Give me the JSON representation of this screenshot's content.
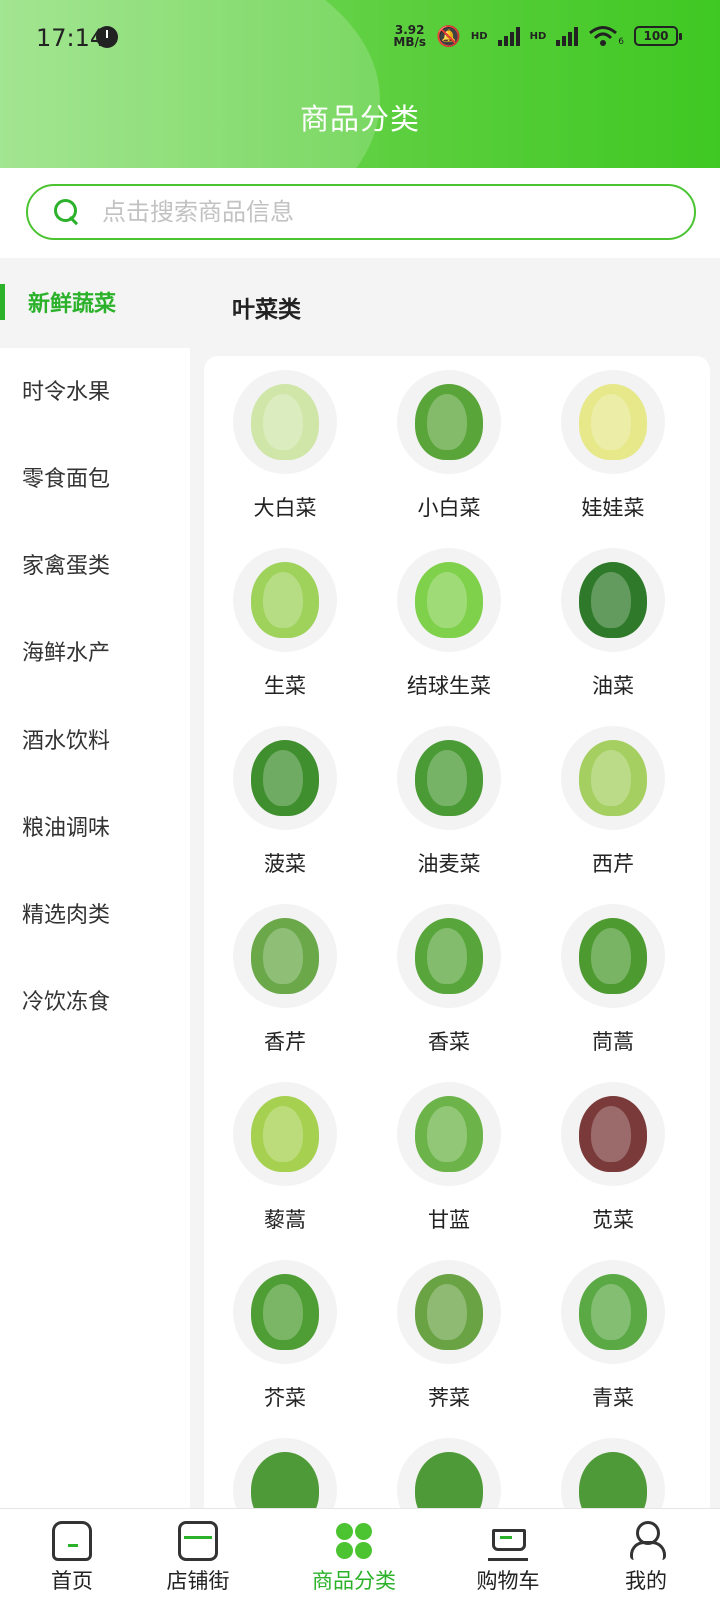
{
  "status_bar": {
    "time": "17:14",
    "net_speed_value": "3.92",
    "net_speed_unit": "MB/s",
    "hd1": "HD",
    "hd2": "HD",
    "wifi_sub": "6",
    "battery": "100"
  },
  "header": {
    "title": "商品分类"
  },
  "search": {
    "placeholder": "点击搜索商品信息",
    "value": ""
  },
  "sidebar": {
    "active": "新鲜蔬菜",
    "items": [
      "时令水果",
      "零食面包",
      "家禽蛋类",
      "海鲜水产",
      "酒水饮料",
      "粮油调味",
      "精选肉类",
      "冷饮冻食"
    ]
  },
  "content": {
    "category_title": "叶菜类",
    "products": [
      {
        "name": "大白菜",
        "icon": "napa-cabbage",
        "color": "#cfe6a8"
      },
      {
        "name": "小白菜",
        "icon": "bok-choy",
        "color": "#5aa53a"
      },
      {
        "name": "娃娃菜",
        "icon": "baby-cabbage",
        "color": "#e6e88a"
      },
      {
        "name": "生菜",
        "icon": "lettuce",
        "color": "#9ed25a"
      },
      {
        "name": "结球生菜",
        "icon": "iceberg-lettuce",
        "color": "#7fd04a"
      },
      {
        "name": "油菜",
        "icon": "rape-greens",
        "color": "#2f7a2a"
      },
      {
        "name": "菠菜",
        "icon": "spinach",
        "color": "#3f8f2e"
      },
      {
        "name": "油麦菜",
        "icon": "indian-lettuce",
        "color": "#4a9a35"
      },
      {
        "name": "西芹",
        "icon": "celery",
        "color": "#a6cf62"
      },
      {
        "name": "香芹",
        "icon": "celery-leaf",
        "color": "#6aa84a"
      },
      {
        "name": "香菜",
        "icon": "coriander",
        "color": "#58a63b"
      },
      {
        "name": "茼蒿",
        "icon": "crown-daisy",
        "color": "#4d9a31"
      },
      {
        "name": "藜蒿",
        "icon": "artemisia",
        "color": "#a6d04f"
      },
      {
        "name": "甘蓝",
        "icon": "cabbage",
        "color": "#6cb449"
      },
      {
        "name": "苋菜",
        "icon": "amaranth",
        "color": "#7a3a3a"
      },
      {
        "name": "芥菜",
        "icon": "mustard-greens",
        "color": "#4f9e35"
      },
      {
        "name": "荠菜",
        "icon": "shepherds-purse",
        "color": "#6aa344"
      },
      {
        "name": "青菜",
        "icon": "green-vegetable",
        "color": "#5aa945"
      }
    ]
  },
  "tabbar": {
    "tabs": [
      {
        "label": "首页",
        "icon": "home-icon"
      },
      {
        "label": "店铺街",
        "icon": "shop-icon"
      },
      {
        "label": "商品分类",
        "icon": "category-icon"
      },
      {
        "label": "购物车",
        "icon": "cart-icon"
      },
      {
        "label": "我的",
        "icon": "profile-icon"
      }
    ],
    "active_index": 2,
    "active_color": "#2bb12a"
  }
}
